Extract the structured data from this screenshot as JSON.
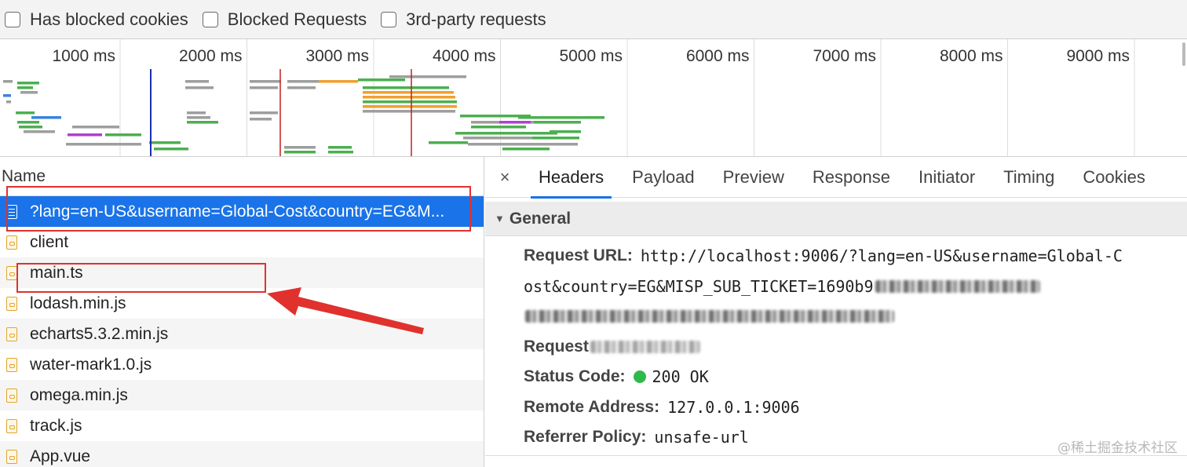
{
  "filters": [
    {
      "label": "Has blocked cookies",
      "checked": false
    },
    {
      "label": "Blocked Requests",
      "checked": false
    },
    {
      "label": "3rd-party requests",
      "checked": false
    }
  ],
  "timeline": {
    "ticks": [
      "1000 ms",
      "2000 ms",
      "3000 ms",
      "4000 ms",
      "5000 ms",
      "6000 ms",
      "7000 ms",
      "8000 ms",
      "9000 ms"
    ],
    "colors": {
      "script": "#4caf50",
      "xhr": "#f0a030",
      "doc": "#3c82e0",
      "other": "#9e9e9e",
      "media": "#b040d0",
      "domcontent": "#1a2fb0",
      "load": "#c02020"
    }
  },
  "request_list": {
    "column_header": "Name",
    "rows": [
      {
        "name": "?lang=en-US&username=Global-Cost&country=EG&M...",
        "type": "document",
        "selected": true
      },
      {
        "name": "client",
        "type": "script"
      },
      {
        "name": "main.ts",
        "type": "script"
      },
      {
        "name": "lodash.min.js",
        "type": "script"
      },
      {
        "name": "echarts5.3.2.min.js",
        "type": "script"
      },
      {
        "name": "water-mark1.0.js",
        "type": "script"
      },
      {
        "name": "omega.min.js",
        "type": "script"
      },
      {
        "name": "track.js",
        "type": "script"
      },
      {
        "name": "App.vue",
        "type": "script"
      }
    ]
  },
  "details": {
    "close_glyph": "×",
    "tabs": [
      "Headers",
      "Payload",
      "Preview",
      "Response",
      "Initiator",
      "Timing",
      "Cookies"
    ],
    "active_tab": "Headers",
    "section_title": "General",
    "general": {
      "request_url_label": "Request URL:",
      "request_url_line1": "http://localhost:9006/?lang=en-US&username=Global-C",
      "request_url_line2": "ost&country=EG&MISP_SUB_TICKET=1690b9",
      "request_method_label": "Request",
      "status_code_label": "Status Code:",
      "status_code_value": "200 OK",
      "remote_address_label": "Remote Address:",
      "remote_address_value": "127.0.0.1:9006",
      "referrer_policy_label": "Referrer Policy:",
      "referrer_policy_value": "unsafe-url"
    }
  },
  "watermark": "@稀土掘金技术社区"
}
